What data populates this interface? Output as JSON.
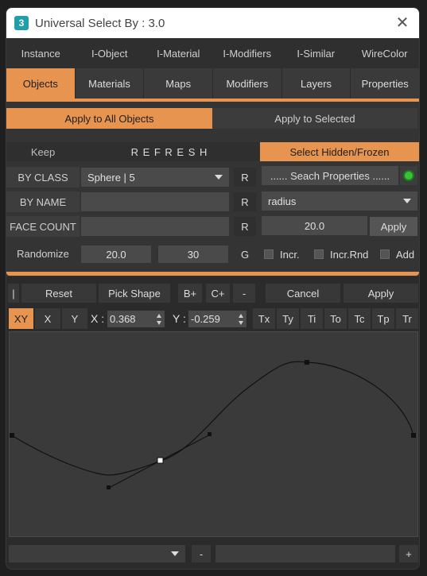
{
  "window": {
    "title": "Universal Select By : 3.0",
    "app_icon": "3"
  },
  "tabs_row1": [
    "Instance",
    "I-Object",
    "I-Material",
    "I-Modifiers",
    "I-Similar",
    "WireColor"
  ],
  "tabs_row2": [
    "Objects",
    "Materials",
    "Maps",
    "Modifiers",
    "Layers",
    "Properties"
  ],
  "active_tab": "Objects",
  "apply_mode": {
    "all": "Apply to All Objects",
    "selected": "Apply to Selected",
    "active": "all"
  },
  "refresh_row": {
    "keep": "Keep",
    "refresh": "R E F R E S H",
    "hidden": "Select Hidden/Frozen"
  },
  "by_class": {
    "label": "BY CLASS",
    "value": "Sphere | 5",
    "r": "R",
    "search": "...... Seach Properties ......"
  },
  "by_name": {
    "label": "BY NAME",
    "value": "",
    "r": "R",
    "property": "radius"
  },
  "face_count": {
    "label": "FACE COUNT",
    "value": "",
    "r": "R",
    "amount": "20.0",
    "apply": "Apply"
  },
  "randomize": {
    "label": "Randomize",
    "v1": "20.0",
    "v2": "30",
    "g": "G",
    "incr": "Incr.",
    "incr_rnd": "Incr.Rnd",
    "add": "Add"
  },
  "curve_toolbar": {
    "pipe": "|",
    "reset": "Reset",
    "pick_shape": "Pick Shape",
    "bplus": "B+",
    "cplus": "C+",
    "minus": "-",
    "cancel": "Cancel",
    "apply": "Apply"
  },
  "axis_toolbar": {
    "xy": "XY",
    "x": "X",
    "y": "Y",
    "x_label": "X :",
    "x_value": "0.368",
    "y_label": "Y :",
    "y_value": "-0.259",
    "transforms": [
      "Tx",
      "Ty",
      "Ti",
      "To",
      "Tc",
      "Tp",
      "Tr"
    ]
  },
  "bottom": {
    "minus": "-",
    "plus": "+"
  },
  "colors": {
    "accent": "#e6944f",
    "green": "#3ac13a"
  }
}
